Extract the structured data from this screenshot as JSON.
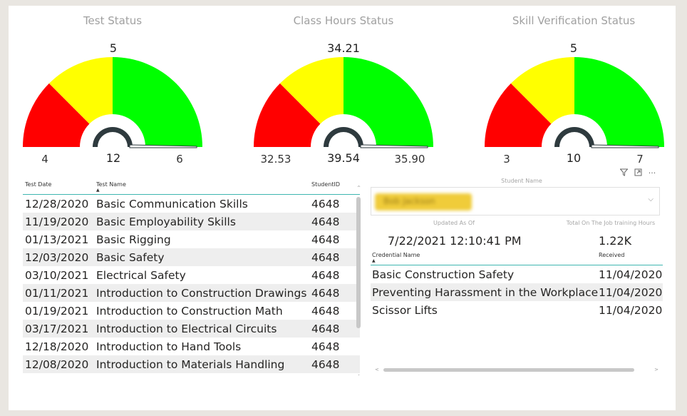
{
  "gauges": [
    {
      "title": "Test Status",
      "target": "5",
      "min": "4",
      "value": "12",
      "max": "6",
      "target_frac": 0.5,
      "needle_frac": 1.0
    },
    {
      "title": "Class Hours Status",
      "target": "34.21",
      "min": "32.53",
      "value": "39.54",
      "max": "35.90",
      "target_frac": 0.5,
      "needle_frac": 1.0
    },
    {
      "title": "Skill Verification Status",
      "target": "5",
      "min": "3",
      "value": "10",
      "max": "7",
      "target_frac": 0.5,
      "needle_frac": 1.0
    }
  ],
  "colors": {
    "red": "#ff0000",
    "yellow": "#ffff00",
    "green": "#00ff00",
    "needle": "#2e3a3e",
    "accent": "#3fb6b0"
  },
  "test_table": {
    "headers": {
      "date": "Test Date",
      "name": "Test Name",
      "sid": "StudentID"
    },
    "rows": [
      {
        "date": "12/28/2020",
        "name": "Basic Communication Skills",
        "sid": "4648"
      },
      {
        "date": "11/19/2020",
        "name": "Basic Employability Skills",
        "sid": "4648"
      },
      {
        "date": "01/13/2021",
        "name": "Basic Rigging",
        "sid": "4648"
      },
      {
        "date": "12/03/2020",
        "name": "Basic Safety",
        "sid": "4648"
      },
      {
        "date": "03/10/2021",
        "name": "Electrical Safety",
        "sid": "4648"
      },
      {
        "date": "01/11/2021",
        "name": "Introduction to Construction Drawings",
        "sid": "4648"
      },
      {
        "date": "01/19/2021",
        "name": "Introduction to Construction Math",
        "sid": "4648"
      },
      {
        "date": "03/17/2021",
        "name": "Introduction to Electrical Circuits",
        "sid": "4648"
      },
      {
        "date": "12/18/2020",
        "name": "Introduction to Hand Tools",
        "sid": "4648"
      },
      {
        "date": "12/08/2020",
        "name": "Introduction to Materials Handling",
        "sid": "4648"
      }
    ]
  },
  "student": {
    "slicer_label": "Student Name",
    "name": "Bob Jackson",
    "updated_label": "Updated As Of",
    "updated_value": "7/22/2021 12:10:41 PM",
    "hours_label": "Total On The Job training Hours",
    "hours_value": "1.22K"
  },
  "cred_table": {
    "headers": {
      "cred": "Credential Name",
      "rec": "Received"
    },
    "rows": [
      {
        "cred": "Basic Construction Safety",
        "rec": "11/04/2020"
      },
      {
        "cred": "Preventing Harassment in the Workplace",
        "rec": "11/04/2020"
      },
      {
        "cred": "Scissor Lifts",
        "rec": "11/04/2020"
      }
    ]
  },
  "visual_icons": [
    "filter-icon",
    "focus-mode-icon",
    "more-options-icon"
  ]
}
